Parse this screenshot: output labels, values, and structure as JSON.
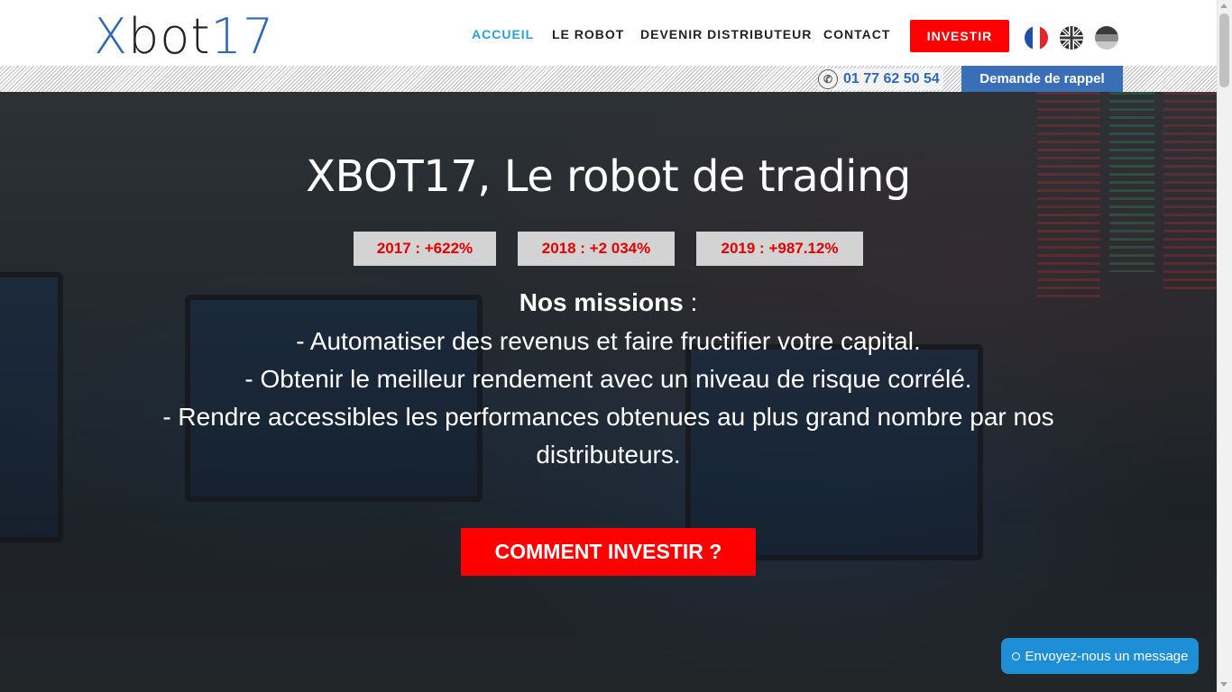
{
  "header": {
    "logo": {
      "x": "X",
      "bot": "bot",
      "num": "17"
    },
    "nav": [
      {
        "label": "ACCUEIL",
        "active": true
      },
      {
        "label": "LE ROBOT",
        "active": false
      },
      {
        "label": "DEVENIR DISTRIBUTEUR",
        "active": false
      },
      {
        "label": "CONTACT",
        "active": false
      }
    ],
    "cta_label": "INVESTIR",
    "languages": [
      "fr-flag-icon",
      "uk-flag-icon",
      "de-flag-icon"
    ]
  },
  "subbar": {
    "phone": "01 77 62 50 54",
    "callback_label": "Demande de rappel"
  },
  "hero": {
    "title": "XBOT17, Le robot de trading",
    "stats": [
      "2017 : +622%",
      "2018 : +2 034%",
      "2019 : +987.12%"
    ],
    "missions_heading": "Nos missions",
    "missions_colon": " :",
    "missions": [
      "- Automatiser des revenus et faire fructifier votre capital.",
      "- Obtenir le meilleur rendement avec un niveau de risque corrélé.",
      "- Rendre accessibles les performances obtenues au plus grand nombre par nos",
      "distributeurs."
    ],
    "cta_label": "COMMENT INVESTIR ?"
  },
  "chat": {
    "label": "Envoyez-nous un message"
  },
  "colors": {
    "accent_red": "#ff0000",
    "brand_blue": "#2e6ab3",
    "active_nav": "#2a9fd6",
    "chat_blue": "#1e8fd6"
  }
}
